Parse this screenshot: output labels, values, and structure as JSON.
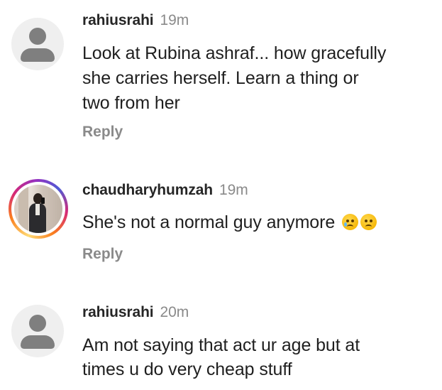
{
  "comments": [
    {
      "username": "rahiusrahi",
      "time": "19m",
      "lines": [
        "Look at Rubina ashraf... how gracefully",
        "she carries herself. Learn a thing or",
        "two from her"
      ],
      "reply_label": "Reply",
      "avatar": "default-avatar-icon"
    },
    {
      "username": "chaudharyhumzah",
      "time": "19m",
      "lines": [
        "She's not a normal guy anymore"
      ],
      "emojis": [
        "crying-face-emoji",
        "sad-face-emoji"
      ],
      "reply_label": "Reply",
      "avatar": "profile-photo"
    },
    {
      "username": "rahiusrahi",
      "time": "20m",
      "lines": [
        "Am not saying that act ur age but at",
        "times u do very cheap stuff"
      ],
      "avatar": "default-avatar-icon"
    }
  ],
  "colors": {
    "username": "#262626",
    "secondary": "#8a8a8a",
    "avatar_placeholder": "#7f7f7f"
  }
}
